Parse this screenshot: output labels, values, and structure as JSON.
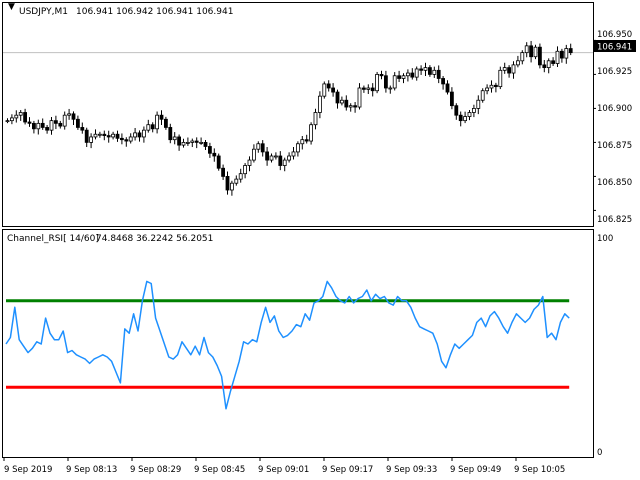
{
  "colors": {
    "background": "#ffffff",
    "frame": "#000000",
    "candle": "#000000",
    "bid_line": "#c0c0c0",
    "price_tag_bg": "#000000",
    "price_tag_fg": "#ffffff",
    "rsi": "#1e90ff",
    "upper_channel": "#008000",
    "lower_channel": "#ff0000"
  },
  "chart_data": [
    {
      "type": "candlestick",
      "title": "USDJPY,M1",
      "ohlc_header": "106.941 106.942 106.941 106.941",
      "current_price": "106.941",
      "ylim": [
        106.815,
        106.965
      ],
      "y_ticks": [
        106.825,
        106.85,
        106.875,
        106.9,
        106.925,
        106.95
      ],
      "y_tick_labels": [
        "106.825",
        "106.850",
        "106.875",
        "106.900",
        "106.925",
        "106.950"
      ],
      "close": [
        106.891,
        106.893,
        106.895,
        106.897,
        106.89,
        106.889,
        106.885,
        106.889,
        106.886,
        106.884,
        106.891,
        106.889,
        106.887,
        106.895,
        106.896,
        106.892,
        106.886,
        106.884,
        106.875,
        106.879,
        106.881,
        106.881,
        106.88,
        106.879,
        106.881,
        106.878,
        106.877,
        106.876,
        106.879,
        106.882,
        106.879,
        106.884,
        106.888,
        106.885,
        106.895,
        106.892,
        106.886,
        106.877,
        106.879,
        106.873,
        106.875,
        106.875,
        106.876,
        106.875,
        106.875,
        106.872,
        106.867,
        106.865,
        106.856,
        106.85,
        106.84,
        106.845,
        106.848,
        106.852,
        106.858,
        106.862,
        106.87,
        106.874,
        106.868,
        106.862,
        106.865,
        106.865,
        106.858,
        106.862,
        106.865,
        106.868,
        106.874,
        106.877,
        106.876,
        106.888,
        106.897,
        106.909,
        106.918,
        106.915,
        106.912,
        106.904,
        106.906,
        106.901,
        106.902,
        106.901,
        106.915,
        106.914,
        106.915,
        106.913,
        106.925,
        106.924,
        106.915,
        106.915,
        106.924,
        106.922,
        106.924,
        106.926,
        106.923,
        106.929,
        106.928,
        106.93,
        106.925,
        106.928,
        106.922,
        106.918,
        106.912,
        106.902,
        106.895,
        106.891,
        106.894,
        106.897,
        106.9,
        106.906,
        106.913,
        106.915,
        106.917,
        106.916,
        106.928,
        106.93,
        106.926,
        106.932,
        106.935,
        106.941,
        106.946,
        106.938,
        106.945,
        106.932,
        106.93,
        106.935,
        106.933,
        106.942,
        106.937,
        106.944,
        106.941
      ],
      "x_tick_labels": [
        "9 Sep 2019",
        "9 Sep 08:13",
        "9 Sep 08:29",
        "9 Sep 08:45",
        "9 Sep 09:01",
        "9 Sep 09:17",
        "9 Sep 09:33",
        "9 Sep 09:49",
        "9 Sep 10:05"
      ]
    },
    {
      "type": "line",
      "title": "Channel_RSI[ 14/60]",
      "values_header": "74.8468 36.2242 56.2051",
      "ylim": [
        0,
        100
      ],
      "y_tick_labels": [
        "100",
        "0"
      ],
      "series": [
        {
          "name": "rsi",
          "values": [
            50,
            53,
            67,
            52,
            49,
            46,
            48,
            51,
            50,
            62,
            55,
            52,
            52,
            56,
            46,
            47,
            45,
            44,
            43,
            41,
            43,
            44,
            45,
            44,
            42,
            37,
            32,
            57,
            55,
            64,
            56,
            70,
            79,
            78,
            62,
            56,
            50,
            44,
            43,
            45,
            51,
            48,
            45,
            49,
            45,
            53,
            46,
            44,
            40,
            35,
            20,
            28,
            35,
            42,
            51,
            50,
            52,
            51,
            60,
            67,
            60,
            63,
            56,
            53,
            54,
            56,
            59,
            58,
            64,
            61,
            69,
            70,
            72,
            79,
            76,
            72,
            70,
            69,
            72,
            69,
            71,
            72,
            75,
            70,
            73,
            71,
            72,
            69,
            68,
            72,
            70,
            70,
            67,
            62,
            58,
            57,
            56,
            55,
            50,
            42,
            39,
            45,
            50,
            48,
            50,
            52,
            54,
            60,
            62,
            58,
            63,
            65,
            62,
            58,
            55,
            60,
            64,
            62,
            60,
            62,
            66,
            68,
            72,
            53,
            55,
            52,
            60,
            64,
            62
          ],
          "x_offset": 0
        },
        {
          "name": "upper",
          "values": [
            70,
            70,
            70,
            70,
            70,
            70,
            70,
            70,
            70,
            70,
            70,
            70,
            70,
            70,
            70,
            70,
            70,
            70,
            70,
            70,
            70,
            70,
            70,
            70,
            70,
            70,
            70,
            70,
            70,
            70,
            70,
            70,
            70,
            70,
            70,
            70,
            70,
            70,
            70,
            70,
            70,
            70,
            70,
            70,
            70,
            70,
            70,
            70,
            70,
            70,
            70,
            70,
            70,
            70,
            70,
            70,
            70,
            70,
            70,
            70,
            70,
            70,
            70,
            70,
            70,
            70,
            70,
            70,
            70,
            70,
            70,
            70,
            70,
            70,
            70,
            70,
            70,
            70,
            70,
            70,
            70,
            70,
            70,
            70,
            70,
            70,
            70,
            70,
            70,
            70,
            70,
            70,
            70,
            70,
            70,
            70,
            70,
            70,
            70,
            70,
            70,
            70,
            70,
            70,
            70,
            70,
            70,
            70,
            70,
            70,
            70,
            70,
            70,
            70,
            70,
            70,
            70,
            70,
            70,
            70,
            70,
            70,
            70,
            70,
            70,
            70,
            70,
            70,
            70
          ],
          "x_offset": 0
        },
        {
          "name": "lower",
          "values": [
            30,
            30,
            30,
            30,
            30,
            30,
            30,
            30,
            30,
            30,
            30,
            30,
            30,
            30,
            30,
            30,
            30,
            30,
            30,
            30,
            30,
            30,
            30,
            30,
            30,
            30,
            30,
            30,
            30,
            30,
            30,
            30,
            30,
            30,
            30,
            30,
            30,
            30,
            30,
            30,
            30,
            30,
            30,
            30,
            30,
            30,
            30,
            30,
            30,
            30,
            30,
            30,
            30,
            30,
            30,
            30,
            30,
            30,
            30,
            30,
            30,
            30,
            30,
            30,
            30,
            30,
            30,
            30,
            30,
            30,
            30,
            30,
            30,
            30,
            30,
            30,
            30,
            30,
            30,
            30,
            30,
            30,
            30,
            30,
            30,
            30,
            30,
            30,
            30,
            30,
            30,
            30,
            30,
            30,
            30,
            30,
            30,
            30,
            30,
            30,
            30,
            30,
            30,
            30,
            30,
            30,
            30,
            30,
            30,
            30,
            30,
            30,
            30,
            30,
            30,
            30,
            30,
            30,
            30,
            30,
            30,
            30,
            30,
            30,
            30,
            30,
            30,
            30,
            30
          ],
          "x_offset": 0
        }
      ]
    }
  ]
}
